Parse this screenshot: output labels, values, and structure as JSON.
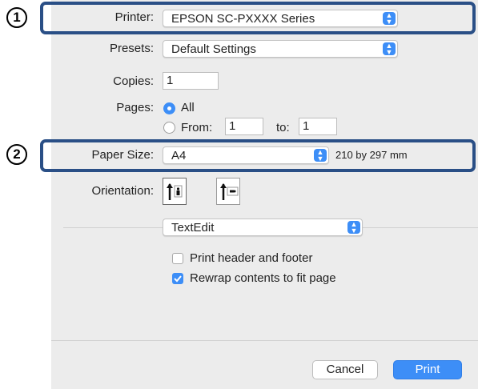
{
  "markers": {
    "one": "1",
    "two": "2"
  },
  "printer": {
    "label": "Printer:",
    "value": "EPSON SC-PXXXX Series"
  },
  "presets": {
    "label": "Presets:",
    "value": "Default Settings"
  },
  "copies": {
    "label": "Copies:",
    "value": "1"
  },
  "pages": {
    "label": "Pages:",
    "all_label": "All",
    "from_label": "From:",
    "from_value": "1",
    "to_label": "to:",
    "to_value": "1"
  },
  "paper_size": {
    "label": "Paper Size:",
    "value": "A4",
    "dimensions": "210 by 297 mm"
  },
  "orientation": {
    "label": "Orientation:"
  },
  "app_menu": {
    "value": "TextEdit"
  },
  "options": {
    "header_footer": "Print header and footer",
    "rewrap": "Rewrap contents to fit page"
  },
  "buttons": {
    "cancel": "Cancel",
    "print": "Print"
  },
  "colors": {
    "accent": "#3d8ef7",
    "highlight": "#2a4f86",
    "dialog_bg": "#ececec"
  }
}
